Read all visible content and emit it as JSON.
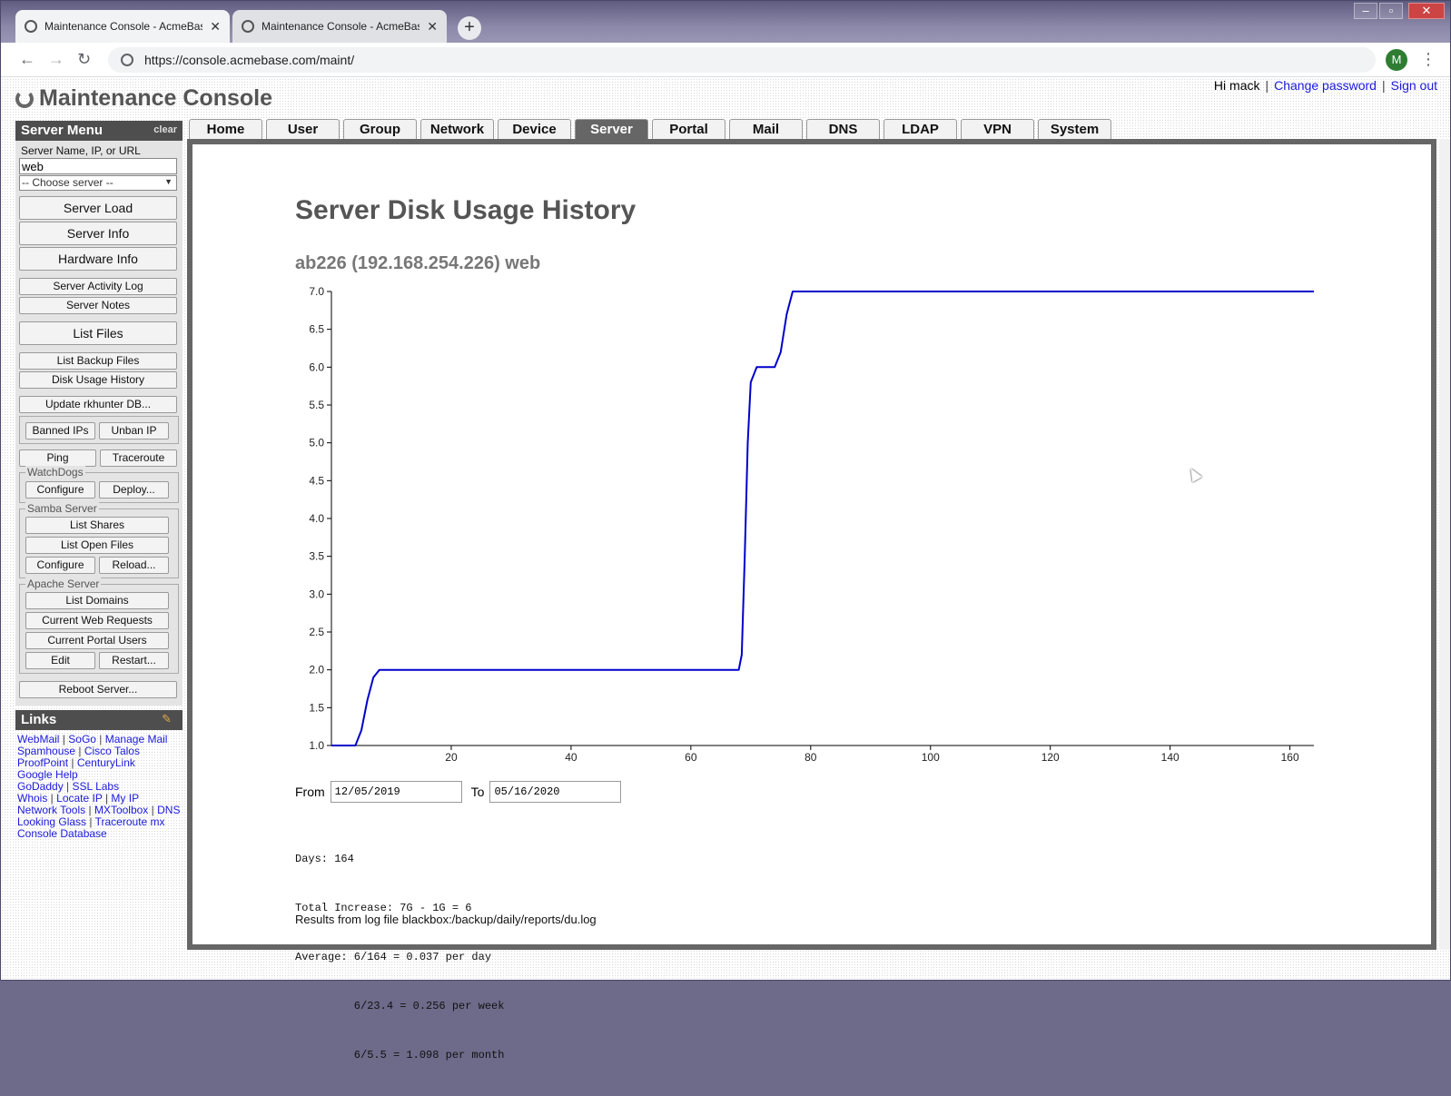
{
  "browser": {
    "tabs": [
      {
        "title": "Maintenance Console - AcmeBas",
        "active": true
      },
      {
        "title": "Maintenance Console - AcmeBas",
        "active": false
      }
    ],
    "url": "https://console.acmebase.com/maint/",
    "profile_initial": "M"
  },
  "header": {
    "app_title": "Maintenance Console",
    "greeting": "Hi mack",
    "change_password": "Change password",
    "sign_out": "Sign out"
  },
  "sidebar": {
    "title": "Server Menu",
    "clear": "clear",
    "server_label": "Server Name, IP, or URL",
    "server_value": "web",
    "choose_server": "-- Choose server --",
    "buttons": {
      "server_load": "Server Load",
      "server_info": "Server Info",
      "hardware_info": "Hardware Info",
      "server_activity_log": "Server Activity Log",
      "server_notes": "Server Notes",
      "list_files": "List Files",
      "list_backup_files": "List Backup Files",
      "disk_usage_history": "Disk Usage History",
      "update_rkhunter": "Update rkhunter DB...",
      "banned_ips": "Banned IPs",
      "unban_ip": "Unban IP",
      "ping": "Ping",
      "traceroute": "Traceroute",
      "reboot_server": "Reboot Server..."
    },
    "watchdogs": {
      "title": "WatchDogs",
      "configure": "Configure",
      "deploy": "Deploy..."
    },
    "samba": {
      "title": "Samba Server",
      "list_shares": "List Shares",
      "list_open_files": "List Open Files",
      "configure": "Configure",
      "reload": "Reload..."
    },
    "apache": {
      "title": "Apache Server",
      "list_domains": "List Domains",
      "current_web_requests": "Current Web Requests",
      "current_portal_users": "Current Portal Users",
      "edit": "Edit",
      "restart": "Restart..."
    },
    "links_title": "Links",
    "links": [
      [
        "WebMail",
        "SoGo",
        "Manage Mail"
      ],
      [
        "Spamhouse",
        "Cisco Talos"
      ],
      [
        "ProofPoint",
        "CenturyLink"
      ],
      [
        "Google Help"
      ],
      [
        "GoDaddy",
        "SSL Labs"
      ],
      [
        "Whois",
        "Locate IP",
        "My IP"
      ],
      [
        "Network Tools",
        "MXToolbox",
        "DNS"
      ],
      [
        "Looking Glass",
        "Traceroute mx"
      ],
      [
        "Console Database"
      ]
    ]
  },
  "nav_tabs": [
    "Home",
    "User",
    "Group",
    "Network",
    "Device",
    "Server",
    "Portal",
    "Mail",
    "DNS",
    "LDAP",
    "VPN",
    "System"
  ],
  "active_tab": "Server",
  "main": {
    "title": "Server Disk Usage History",
    "subtitle": "ab226 (192.168.254.226) web",
    "from_label": "From",
    "from_value": "12/05/2019",
    "to_label": "To",
    "to_value": "05/16/2020",
    "stats": [
      "Days: 164",
      "Total Increase: 7G - 1G = 6",
      "Average: 6/164 = 0.037 per day",
      "         6/23.4 = 0.256 per week",
      "         6/5.5 = 1.098 per month"
    ],
    "log_line": "Results from log file blackbox:/backup/daily/reports/du.log"
  },
  "chart_data": {
    "type": "line",
    "title": "",
    "xlabel": "",
    "ylabel": "",
    "xlim": [
      0,
      164
    ],
    "ylim": [
      1.0,
      7.0
    ],
    "xticks": [
      20,
      40,
      60,
      80,
      100,
      120,
      140,
      160
    ],
    "yticks": [
      1.0,
      1.5,
      2.0,
      2.5,
      3.0,
      3.5,
      4.0,
      4.5,
      5.0,
      5.5,
      6.0,
      6.5,
      7.0
    ],
    "grid": false,
    "color": "#0000cc",
    "series": [
      {
        "x": [
          0,
          4,
          5,
          6,
          7,
          8,
          68,
          68.5,
          69,
          69.5,
          70,
          71,
          74,
          75,
          76,
          77,
          164
        ],
        "y": [
          1,
          1,
          1.2,
          1.6,
          1.9,
          2,
          2,
          2.2,
          3.5,
          5.0,
          5.8,
          6,
          6,
          6.2,
          6.7,
          7,
          7
        ]
      }
    ]
  }
}
